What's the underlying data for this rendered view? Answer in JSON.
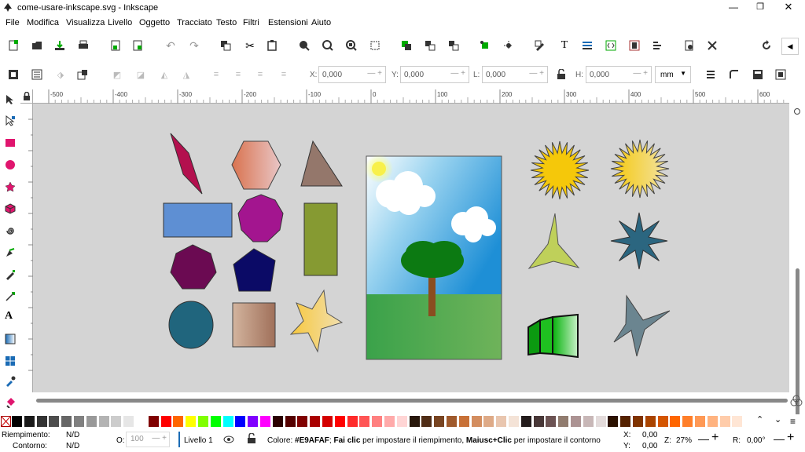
{
  "window": {
    "title": "come-usare-inkscape.svg - Inkscape"
  },
  "menu": [
    "File",
    "Modifica",
    "Visualizza",
    "Livello",
    "Oggetto",
    "Tracciato",
    "Testo",
    "Filtri",
    "Estensioni",
    "Aiuto"
  ],
  "controls": {
    "x_label": "X:",
    "x_value": "0,000",
    "y_label": "Y:",
    "y_value": "0,000",
    "w_label": "L:",
    "w_value": "0,000",
    "h_label": "H:",
    "h_value": "0,000",
    "unit": "mm"
  },
  "ruler_ticks": [
    "-500",
    "-400",
    "-300",
    "-200",
    "-100",
    "0",
    "100",
    "200",
    "300",
    "400",
    "500",
    "600"
  ],
  "palette_colors": [
    "#000000",
    "#1a1a1a",
    "#333333",
    "#4d4d4d",
    "#666666",
    "#808080",
    "#999999",
    "#b3b3b3",
    "#cccccc",
    "#e6e6e6",
    "#ffffff",
    "#800000",
    "#ff0000",
    "#ff6600",
    "#ffff00",
    "#80ff00",
    "#00ff00",
    "#00ffff",
    "#0000ff",
    "#8000ff",
    "#ff00ff",
    "#2b0000",
    "#550000",
    "#800000",
    "#aa0000",
    "#d40000",
    "#ff0000",
    "#ff2a2a",
    "#ff5555",
    "#ff8080",
    "#ffaaaa",
    "#ffd5d5",
    "#28170b",
    "#502d16",
    "#784421",
    "#a05a2c",
    "#c87137",
    "#d38d5f",
    "#deaa87",
    "#e9c6af",
    "#f4e3d7",
    "#241c1c",
    "#483737",
    "#6c5353",
    "#917c6f",
    "#ac9393",
    "#c8b7b7",
    "#e3dbdb",
    "#2b1100",
    "#552200",
    "#803300",
    "#aa4400",
    "#d45500",
    "#ff6600",
    "#ff7f2a",
    "#ff9955",
    "#ffb380",
    "#ffccaa",
    "#ffe6d5"
  ],
  "status": {
    "fill_label": "Riempimento:",
    "fill_value": "N/D",
    "stroke_label": "Contorno:",
    "stroke_value": "N/D",
    "opacity_label": "O:",
    "opacity_value": "100",
    "layer": "Livello 1",
    "message_prefix": "Colore: ",
    "message_color": "#E9AFAF",
    "message_sep": "; ",
    "message_bold1": "Fai clic",
    "message_mid": " per impostare il riempimento, ",
    "message_bold2": "Maiusc+Clic",
    "message_end": " per impostare il contorno",
    "x_label": "X:",
    "x_value": "0,00",
    "y_label": "Y:",
    "y_value": "0,00",
    "zoom_label": "Z:",
    "zoom_value": "27%",
    "rot_label": "R:",
    "rot_value": "0,00°"
  }
}
